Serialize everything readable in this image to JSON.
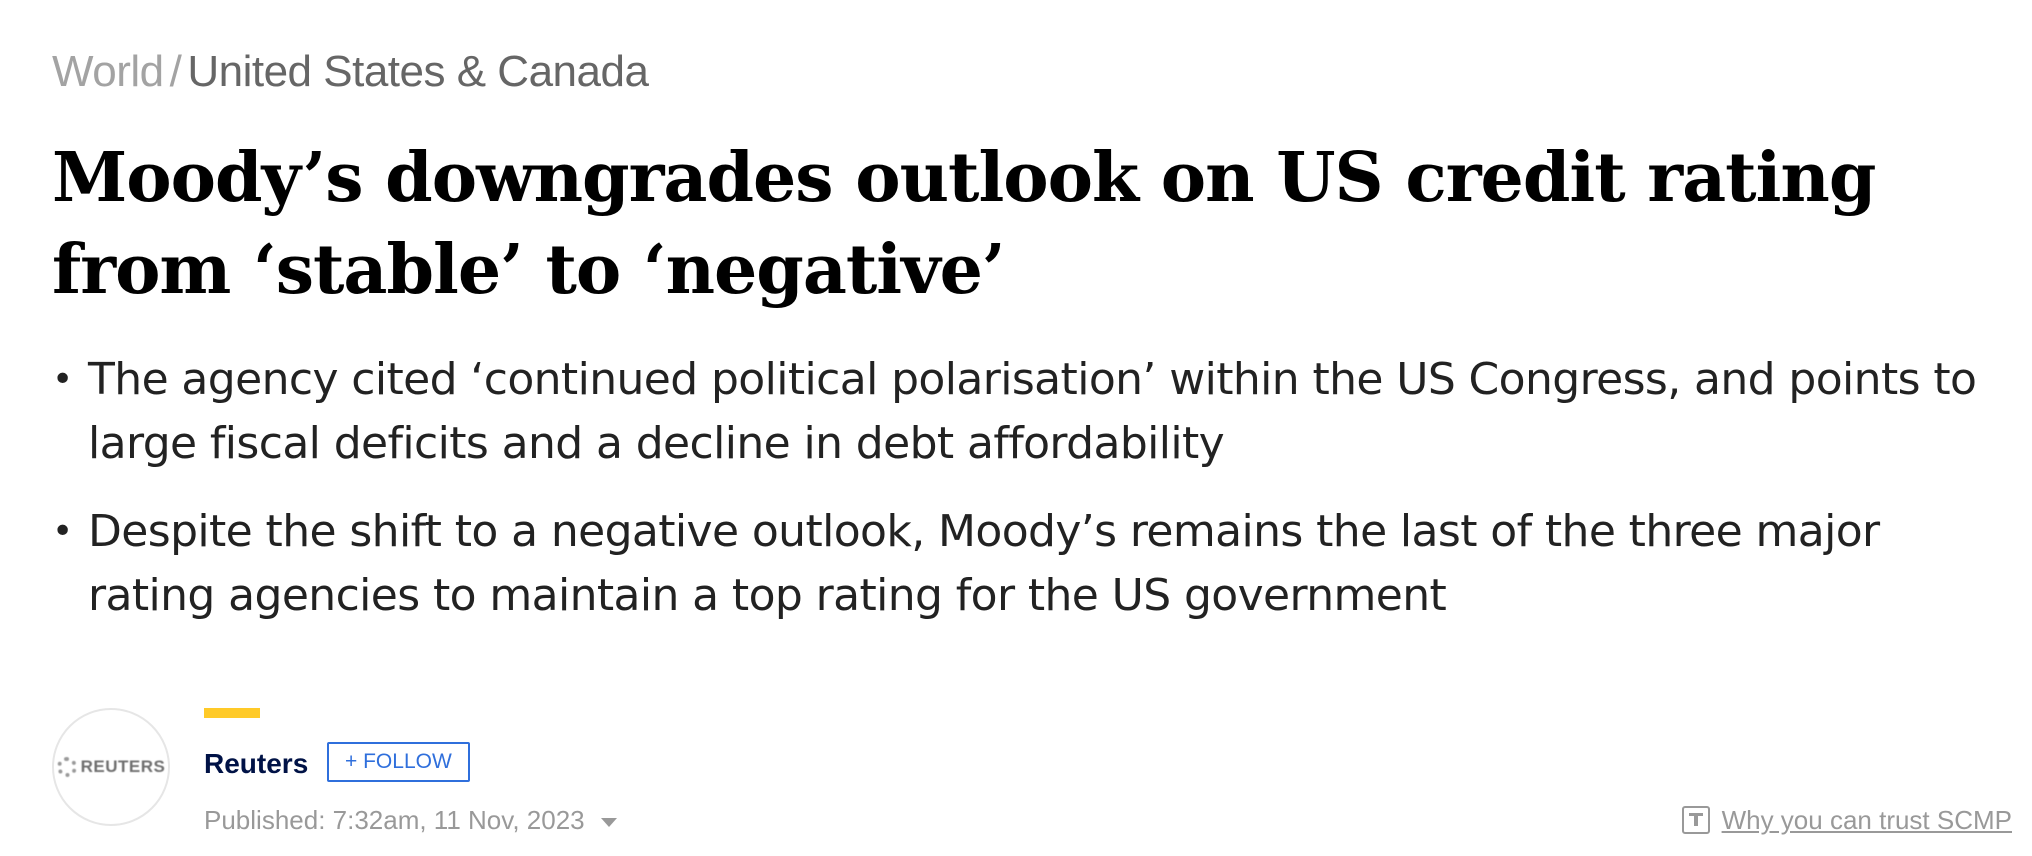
{
  "breadcrumb": {
    "world": "World",
    "separator": "/",
    "section": "United States & Canada"
  },
  "headline": "Moody’s downgrades outlook on US credit rating from ‘stable’ to ‘negative’",
  "summary": [
    "The agency cited ‘continued political polarisation’ within the US Congress, and points to large fiscal deficits and a decline in debt affordability",
    "Despite the shift to a negative outlook, Moody’s remains the last of the three major rating agencies to maintain a top rating for the US government"
  ],
  "byline": {
    "avatar_logo_text": "REUTERS",
    "author": "Reuters",
    "follow_label": "+ FOLLOW",
    "published": "Published: 7:32am, 11 Nov, 2023",
    "trust_link": "Why you can trust SCMP",
    "accent_color": "#ffca28",
    "follow_color": "#2f6fdc",
    "author_color": "#001246"
  },
  "icons": {
    "bullet": "•",
    "caret": "chevron-down-icon",
    "trust": "trust-t-icon"
  }
}
